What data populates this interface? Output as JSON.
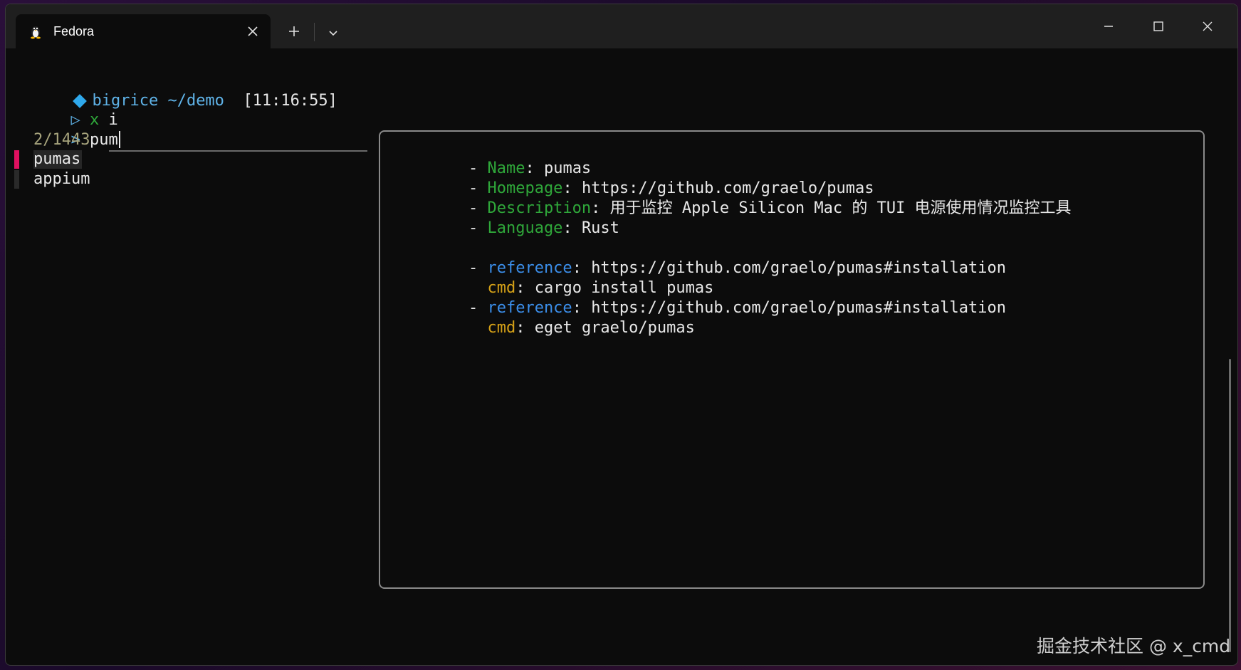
{
  "window": {
    "tab_title": "Fedora",
    "tab_icon": "tux-penguin-icon",
    "new_tab_icon": "plus-icon",
    "dropdown_icon": "chevron-down-icon",
    "controls": [
      "minimize-icon",
      "maximize-icon",
      "close-icon"
    ]
  },
  "terminal": {
    "prompt": {
      "user": "bigrice",
      "path": "~/demo",
      "time": "[11:16:55]"
    },
    "command": {
      "arrow": "▷",
      "x": "x",
      "arg": "i"
    },
    "input": {
      "caret": ">",
      "query": "pum"
    },
    "count": "2/1443",
    "results": [
      "pumas",
      "appium"
    ]
  },
  "preview": {
    "name_key": "Name",
    "name_val": "pumas",
    "homepage_key": "Homepage",
    "homepage_val": "https://github.com/graelo/pumas",
    "description_key": "Description",
    "description_val": "用于监控 Apple Silicon Mac 的 TUI 电源使用情况监控工具",
    "language_key": "Language",
    "language_val": "Rust",
    "installs": [
      {
        "ref_key": "reference",
        "ref_val": "https://github.com/graelo/pumas#installation",
        "cmd_key": "cmd",
        "cmd_val": "cargo install pumas"
      },
      {
        "ref_key": "reference",
        "ref_val": "https://github.com/graelo/pumas#installation",
        "cmd_key": "cmd",
        "cmd_val": "eget graelo/pumas"
      }
    ]
  },
  "watermark": "掘金技术社区 @ x_cmd",
  "colors": {
    "accent_pink": "#e0105f",
    "key_green": "#2fa83a",
    "ref_blue": "#3b8eea",
    "cmd_yellow": "#d4a017",
    "prompt_blue": "#5fb3e8"
  }
}
